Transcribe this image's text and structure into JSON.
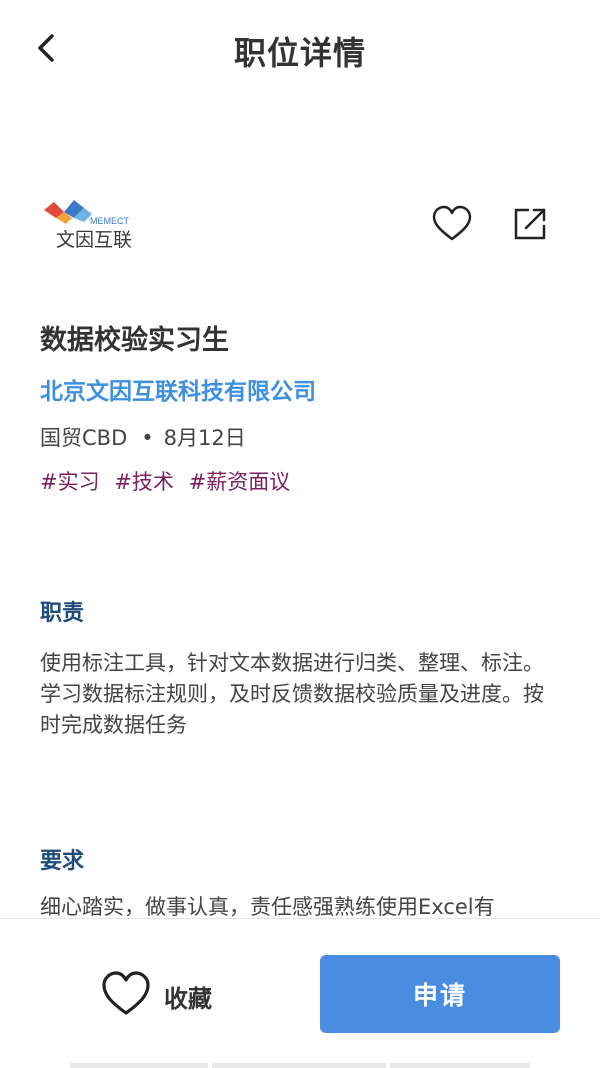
{
  "header": {
    "title": "职位详情"
  },
  "company_logo": {
    "text": "文因互联",
    "brand": "MEMECT"
  },
  "job": {
    "title": "数据校验实习生",
    "company": "北京文因互联科技有限公司",
    "location": "国贸CBD",
    "separator": "•",
    "date": "8月12日",
    "tags": [
      "#实习",
      "#技术",
      "#薪资面议"
    ]
  },
  "sections": {
    "duties": {
      "heading": "职责",
      "text": "使用标注工具，针对文本数据进行归类、整理、标注。学习数据标注规则，及时反馈数据校验质量及进度。按时完成数据任务"
    },
    "requirements": {
      "heading": "要求",
      "text": "细心踏实，做事认真，责任感强熟练使用Excel有"
    }
  },
  "bottom": {
    "favorite_label": "收藏",
    "apply_label": "申请"
  },
  "colors": {
    "accent": "#4a8de0",
    "company_link": "#3d8fe2",
    "tag": "#7a1f5f",
    "section_heading": "#1e4b79"
  },
  "icons": {
    "back": "chevron-left-icon",
    "favorite": "heart-icon",
    "share": "share-icon"
  }
}
